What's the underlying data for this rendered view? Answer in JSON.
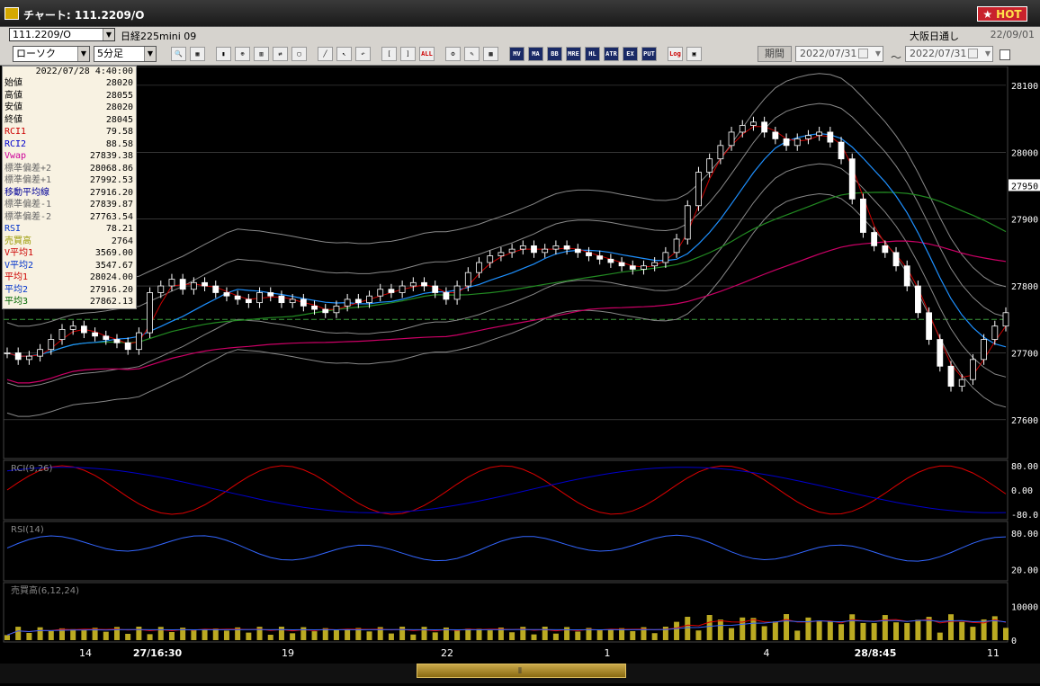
{
  "window": {
    "title": "チャート: 111.2209/O",
    "hot_label": "HOT"
  },
  "instrument": {
    "symbol": "111.2209/O",
    "name": "日経225mini 09",
    "session": "大阪日通し",
    "contract_date": "22/09/01"
  },
  "toolbar": {
    "chart_type": "ローソク",
    "interval": "5分足",
    "period_label": "期間",
    "date_from": "2022/07/31",
    "date_to": "2022/07/31",
    "tilde": "～",
    "icons": [
      "zoom-icon",
      "layout-icon",
      "candle-icon",
      "magnify-icon",
      "bar-icon",
      "compare-icon",
      "blank-icon",
      "trendline-icon",
      "cursor-icon",
      "undo-icon",
      "bracket-left-icon",
      "bracket-right-icon",
      "all-icon",
      "settings-icon",
      "brush-icon",
      "palette-icon",
      "mv-icon",
      "ma-icon",
      "bb-icon",
      "mre-icon",
      "hl-icon",
      "atr-icon",
      "ex-icon",
      "put-icon",
      "log-icon",
      "window-icon"
    ],
    "icon_labels": {
      "all": "ALL",
      "mv": "MV",
      "ma": "MA",
      "bb": "BB",
      "mre": "MRE",
      "hl": "HL",
      "atr": "ATR",
      "ex": "EX",
      "put": "PUT",
      "log": "Log"
    }
  },
  "info_panel": {
    "timestamp": "2022/07/28 4:40:00",
    "rows": [
      {
        "label": "始値",
        "value": "28020",
        "color": "#000000"
      },
      {
        "label": "高値",
        "value": "28055",
        "color": "#000000"
      },
      {
        "label": "安値",
        "value": "28020",
        "color": "#000000"
      },
      {
        "label": "終値",
        "value": "28045",
        "color": "#000000"
      },
      {
        "label": "RCI1",
        "value": "79.58",
        "color": "#cc0000"
      },
      {
        "label": "RCI2",
        "value": "88.58",
        "color": "#0000cc"
      },
      {
        "label": "Vwap",
        "value": "27839.38",
        "color": "#cc0099"
      },
      {
        "label": "標準偏差+2",
        "value": "28068.86",
        "color": "#666666"
      },
      {
        "label": "標準偏差+1",
        "value": "27992.53",
        "color": "#666666"
      },
      {
        "label": "移動平均線",
        "value": "27916.20",
        "color": "#000099"
      },
      {
        "label": "標準偏差-1",
        "value": "27839.87",
        "color": "#666666"
      },
      {
        "label": "標準偏差-2",
        "value": "27763.54",
        "color": "#666666"
      },
      {
        "label": "RSI",
        "value": "78.21",
        "color": "#0033cc"
      },
      {
        "label": "売買高",
        "value": "2764",
        "color": "#999900"
      },
      {
        "label": "V平均1",
        "value": "3569.00",
        "color": "#cc0000"
      },
      {
        "label": "V平均2",
        "value": "3547.67",
        "color": "#0033cc"
      },
      {
        "label": "平均1",
        "value": "28024.00",
        "color": "#cc0000"
      },
      {
        "label": "平均2",
        "value": "27916.20",
        "color": "#0033cc"
      },
      {
        "label": "平均3",
        "value": "27862.13",
        "color": "#006600"
      }
    ]
  },
  "price_axis": {
    "ticks": [
      "28100",
      "28000",
      "27900",
      "27800",
      "27700",
      "27600"
    ],
    "current": "27950"
  },
  "panes": {
    "rci": {
      "label": "RCI(9,26)",
      "ticks": [
        "80.00",
        "0.00",
        "-80.0"
      ]
    },
    "rsi": {
      "label": "RSI(14)",
      "ticks": [
        "80.00",
        "20.00"
      ]
    },
    "volume": {
      "label": "売買高(6,12,24)",
      "ticks": [
        "10000",
        "0"
      ]
    }
  },
  "time_axis": {
    "labels": [
      "14",
      "27/16:30",
      "19",
      "22",
      "1",
      "4",
      "28/8:45",
      "11"
    ]
  },
  "colors": {
    "candle": "#ffffff",
    "ma_short": "#cc0000",
    "ma_mid": "#1e90ff",
    "ma_long": "#228b22",
    "vwap": "#cc0066",
    "band": "#888888",
    "rci1": "#dd0000",
    "rci2": "#0000cc",
    "rsi": "#3366ff",
    "volume": "#bbaa22"
  },
  "chart_data": {
    "type": "line",
    "title": "",
    "price_range": [
      27550,
      28120
    ],
    "price_series": [
      27700,
      27690,
      27695,
      27705,
      27720,
      27735,
      27740,
      27730,
      27725,
      27720,
      27715,
      27705,
      27730,
      27790,
      27800,
      27810,
      27795,
      27805,
      27800,
      27790,
      27785,
      27780,
      27775,
      27790,
      27785,
      27775,
      27780,
      27770,
      27765,
      27760,
      27770,
      27780,
      27775,
      27785,
      27795,
      27790,
      27800,
      27805,
      27800,
      27790,
      27780,
      27800,
      27820,
      27835,
      27845,
      27850,
      27855,
      27860,
      27850,
      27855,
      27860,
      27855,
      27850,
      27845,
      27840,
      27835,
      27830,
      27825,
      27830,
      27835,
      27850,
      27870,
      27920,
      27970,
      27990,
      28010,
      28030,
      28040,
      28045,
      28030,
      28020,
      28010,
      28020,
      28025,
      28030,
      28015,
      27990,
      27930,
      27880,
      27860,
      27850,
      27830,
      27800,
      27760,
      27720,
      27680,
      27650,
      27660,
      27690,
      27720,
      27740,
      27760
    ]
  }
}
